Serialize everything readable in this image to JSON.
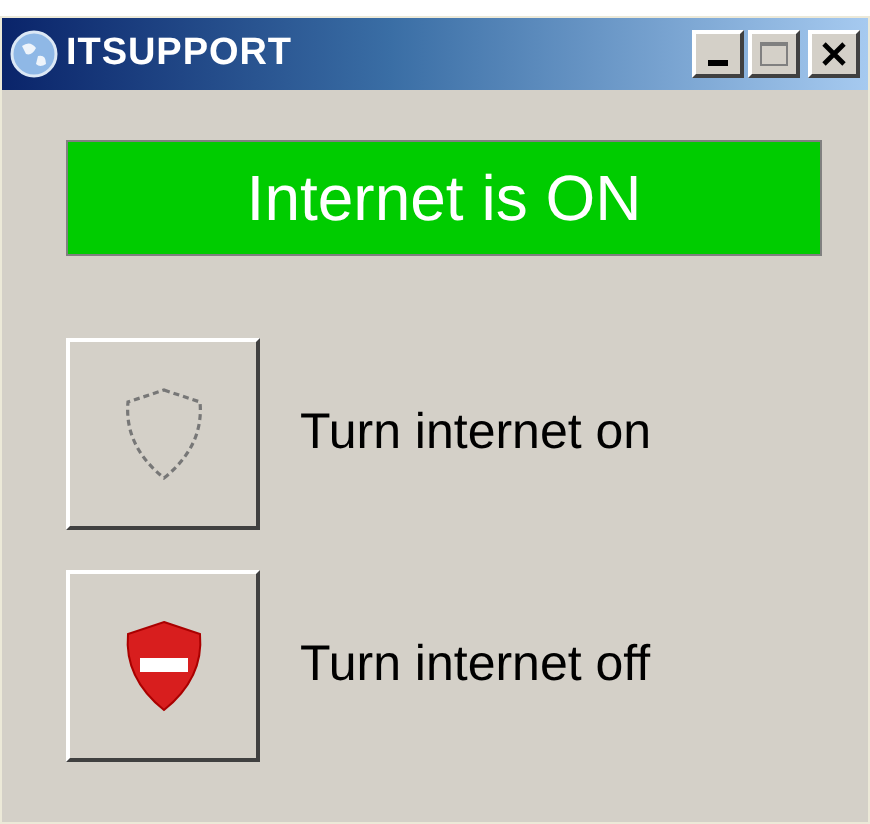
{
  "window": {
    "title": "ITSUPPORT"
  },
  "status": {
    "text": "Internet is ON",
    "on": true
  },
  "actions": [
    {
      "kind": "on",
      "label": "Turn internet on",
      "disabled": true
    },
    {
      "kind": "off",
      "label": "Turn internet off",
      "disabled": false
    }
  ]
}
